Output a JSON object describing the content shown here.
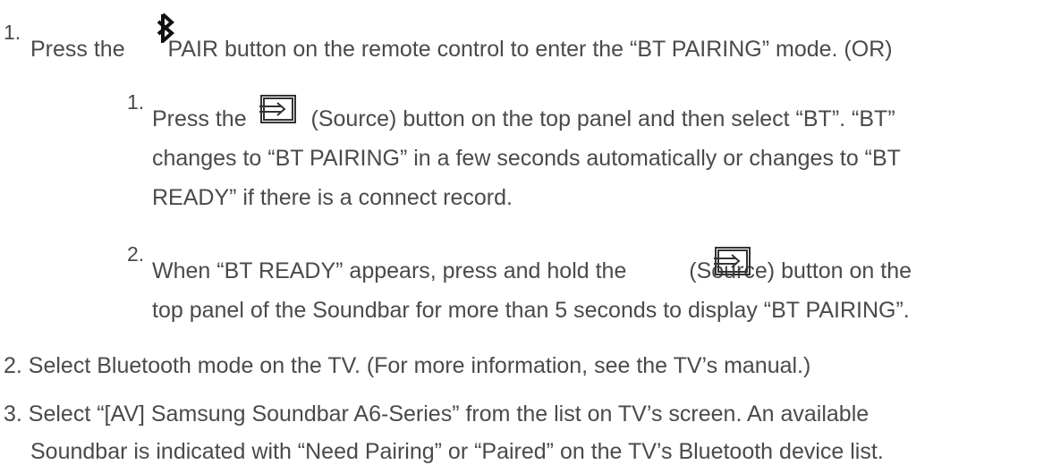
{
  "steps": {
    "step1": {
      "number": "1.",
      "prefix": "Press the",
      "suffix": "PAIR button on the remote control to enter the “BT PAIRING” mode. (OR)",
      "icon": "bluetooth-icon",
      "substeps": [
        {
          "number": "1.",
          "prefix": "Press the",
          "icon": "source-icon",
          "line1_suffix": "(Source) button on the top panel and then select “BT”. “BT”",
          "line2": "changes to “BT PAIRING” in a few seconds automatically or changes to “BT",
          "line3": "READY” if there is a connect record."
        },
        {
          "number": "2.",
          "prefix": "When “BT READY” appears, press and hold the",
          "icon": "source-icon",
          "line1_suffix": "(Source) button on the",
          "line2": "top panel of the Soundbar for more than 5 seconds to display “BT PAIRING”."
        }
      ]
    },
    "step2": {
      "text": "2. Select Bluetooth mode on the TV. (For more information, see the TV’s manual.)"
    },
    "step3": {
      "line1": "3. Select “[AV] Samsung Soundbar A6-Series” from the list on TV’s screen. An available",
      "line2": "Soundbar is indicated with “Need Pairing” or “Paired” on the TV’s Bluetooth device list."
    }
  },
  "colors": {
    "text": "#4a4a4a",
    "icon": "#111111"
  }
}
